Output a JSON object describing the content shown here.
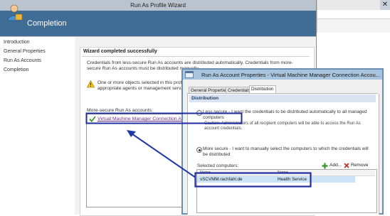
{
  "wizard": {
    "title": "Run As Profile Wizard",
    "close_glyph": "✕",
    "header_title": "Completion",
    "header_icon": "user-wizard-icon",
    "nav_items": [
      "Introduction",
      "General Properties",
      "Run As Accounts",
      "Completion"
    ],
    "completed_title": "Wizard completed successfully",
    "description": "Credentials from less-secure Run As accounts are distributed automatically. Credentials from more-secure Run As accounts must be distributed manually.",
    "warning_text": "One or more objects selected in this profile m... the appropriate agents or management serv...",
    "more_secure_label": "More-secure Run As accounts:",
    "account_link": "Virtual Machine Manager Connection Account"
  },
  "properties_dialog": {
    "title": "Run As Account Properties - Virtual Machine Manager Connection Accou...",
    "tabs": [
      "General Properties",
      "Credentials",
      "Distribution"
    ],
    "active_tab": "Distribution",
    "section_title": "Distribution",
    "less_secure_text": "Less secure - I want the credentials to be distributed automatically to all managed computers",
    "caution_text": "Caution: Administrators of all recipient computers will be able to access the Run As account credentials.",
    "more_secure_text": "More secure - I want to manually select the computers to which the credentials will be distributed",
    "selected_option": "more_secure",
    "selected_computers_label": "Selected computers:",
    "add_label": "Add...",
    "remove_label": "Remove",
    "columns": [
      "Name",
      "Name"
    ],
    "rows": [
      {
        "name": "vSCVMM.rachfahl.de",
        "type": "Health Service"
      }
    ]
  },
  "colors": {
    "header_blue": "#3f6d96",
    "highlight_outline": "#1f2d9e",
    "arrow": "#1f3aa8",
    "link_purple": "#6b2b86",
    "check_green": "#3a9a2a"
  }
}
